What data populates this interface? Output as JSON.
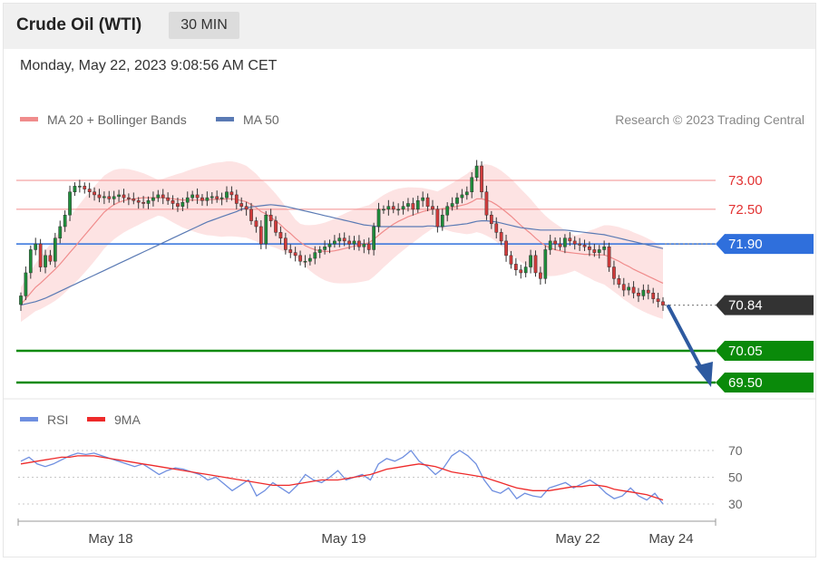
{
  "header": {
    "title": "Crude Oil (WTI)",
    "timeframe": "30 MIN"
  },
  "timestamp": "Monday, May 22, 2023 9:08:56 AM CET",
  "legend": {
    "ma20": "MA 20 + Bollinger Bands",
    "ma50": "MA 50",
    "credit": "Research © 2023 Trading Central"
  },
  "rsi_legend": {
    "rsi": "RSI",
    "ma9": "9MA"
  },
  "colors": {
    "up": "#1e8c3a",
    "down": "#d23b3b",
    "ma20": "#f08c8c",
    "bands": "#fde0e0",
    "ma50": "#5a7ab4",
    "pivot": "#2f6fdc",
    "support": "#0a8a0a",
    "current": "#333333",
    "rsi": "#6f8fe0",
    "rsi9": "#ee2a2a",
    "resistance": "#f28c8c",
    "arrow": "#2e5aa0"
  },
  "chart_data": [
    {
      "type": "candlestick",
      "title": "Crude Oil (WTI)",
      "timeframe": "30 MIN",
      "x_ticks": [
        "May 18",
        "May 19",
        "May 22",
        "May 24"
      ],
      "ylim": [
        69.3,
        73.6
      ],
      "levels": [
        {
          "value": 73.0,
          "label": "73.00",
          "kind": "resistance"
        },
        {
          "value": 72.5,
          "label": "72.50",
          "kind": "resistance"
        },
        {
          "value": 71.9,
          "label": "71.90",
          "kind": "pivot"
        },
        {
          "value": 70.84,
          "label": "70.84",
          "kind": "current"
        },
        {
          "value": 70.05,
          "label": "70.05",
          "kind": "support"
        },
        {
          "value": 69.5,
          "label": "69.50",
          "kind": "support"
        }
      ],
      "close": [
        71.0,
        71.4,
        71.8,
        71.9,
        71.5,
        71.7,
        71.6,
        72.0,
        72.2,
        72.4,
        72.8,
        72.9,
        72.9,
        72.85,
        72.8,
        72.75,
        72.7,
        72.72,
        72.68,
        72.72,
        72.75,
        72.7,
        72.68,
        72.65,
        72.62,
        72.6,
        72.65,
        72.7,
        72.75,
        72.7,
        72.65,
        72.6,
        72.55,
        72.62,
        72.7,
        72.75,
        72.7,
        72.65,
        72.7,
        72.72,
        72.68,
        72.7,
        72.8,
        72.75,
        72.6,
        72.55,
        72.5,
        72.3,
        72.2,
        71.9,
        72.4,
        72.3,
        72.1,
        72.0,
        71.8,
        71.75,
        71.7,
        71.6,
        71.6,
        71.65,
        71.75,
        71.8,
        71.85,
        71.9,
        71.95,
        72.0,
        71.95,
        71.9,
        71.95,
        71.85,
        71.9,
        71.8,
        72.2,
        72.5,
        72.5,
        72.55,
        72.5,
        72.5,
        72.55,
        72.6,
        72.5,
        72.65,
        72.7,
        72.55,
        72.5,
        72.2,
        72.4,
        72.55,
        72.6,
        72.7,
        72.75,
        72.8,
        73.05,
        73.25,
        72.8,
        72.4,
        72.25,
        72.1,
        71.95,
        71.7,
        71.55,
        71.45,
        71.4,
        71.5,
        71.7,
        71.4,
        71.3,
        71.8,
        71.95,
        71.9,
        71.85,
        72.0,
        71.95,
        71.9,
        71.88,
        71.85,
        71.8,
        71.75,
        71.8,
        71.85,
        71.5,
        71.3,
        71.2,
        71.1,
        71.15,
        71.05,
        71.0,
        71.1,
        71.05,
        70.95,
        70.9,
        70.84
      ],
      "ma20": [
        70.85,
        70.95,
        71.05,
        71.15,
        71.22,
        71.3,
        71.38,
        71.46,
        71.55,
        71.65,
        71.75,
        71.85,
        71.95,
        72.05,
        72.15,
        72.25,
        72.35,
        72.45,
        72.52,
        72.58,
        72.62,
        72.65,
        72.67,
        72.68,
        72.69,
        72.7,
        72.7,
        72.7,
        72.7,
        72.7,
        72.69,
        72.68,
        72.67,
        72.66,
        72.66,
        72.66,
        72.66,
        72.66,
        72.66,
        72.67,
        72.67,
        72.67,
        72.68,
        72.68,
        72.67,
        72.65,
        72.63,
        72.58,
        72.53,
        72.46,
        72.42,
        72.36,
        72.3,
        72.23,
        72.15,
        72.08,
        72.0,
        71.93,
        71.87,
        71.83,
        71.8,
        71.78,
        71.77,
        71.77,
        71.78,
        71.8,
        71.82,
        71.84,
        71.86,
        71.88,
        71.9,
        71.92,
        71.98,
        72.05,
        72.12,
        72.18,
        72.24,
        72.29,
        72.33,
        72.37,
        72.4,
        72.43,
        72.46,
        72.48,
        72.5,
        72.5,
        72.51,
        72.52,
        72.53,
        72.55,
        72.57,
        72.59,
        72.63,
        72.68,
        72.68,
        72.66,
        72.63,
        72.58,
        72.52,
        72.45,
        72.38,
        72.3,
        72.22,
        72.15,
        72.08,
        72.0,
        71.93,
        71.87,
        71.83,
        71.8,
        71.78,
        71.76,
        71.75,
        71.74,
        71.73,
        71.72,
        71.72,
        71.71,
        71.71,
        71.71,
        71.68,
        71.64,
        71.6,
        71.55,
        71.51,
        71.46,
        71.42,
        71.38,
        71.34,
        71.3,
        71.26,
        71.22
      ],
      "ma50": [
        70.84,
        70.86,
        70.88,
        70.9,
        70.93,
        70.96,
        71.0,
        71.04,
        71.08,
        71.12,
        71.16,
        71.2,
        71.24,
        71.28,
        71.32,
        71.36,
        71.4,
        71.44,
        71.48,
        71.52,
        71.56,
        71.6,
        71.64,
        71.68,
        71.72,
        71.76,
        71.8,
        71.84,
        71.88,
        71.92,
        71.96,
        72.0,
        72.04,
        72.08,
        72.12,
        72.16,
        72.2,
        72.24,
        72.28,
        72.31,
        72.34,
        72.37,
        72.4,
        72.43,
        72.46,
        72.5,
        72.52,
        72.54,
        72.55,
        72.56,
        72.57,
        72.58,
        72.57,
        72.56,
        72.55,
        72.53,
        72.51,
        72.49,
        72.47,
        72.45,
        72.43,
        72.41,
        72.39,
        72.37,
        72.35,
        72.33,
        72.31,
        72.29,
        72.27,
        72.25,
        72.23,
        72.22,
        72.21,
        72.2,
        72.2,
        72.2,
        72.2,
        72.2,
        72.2,
        72.2,
        72.2,
        72.2,
        72.2,
        72.21,
        72.21,
        72.2,
        72.2,
        72.21,
        72.22,
        72.23,
        72.24,
        72.25,
        72.27,
        72.29,
        72.3,
        72.3,
        72.29,
        72.28,
        72.26,
        72.24,
        72.22,
        72.2,
        72.18,
        72.17,
        72.16,
        72.15,
        72.14,
        72.14,
        72.14,
        72.14,
        72.14,
        72.14,
        72.13,
        72.12,
        72.11,
        72.1,
        72.09,
        72.08,
        72.07,
        72.06,
        72.04,
        72.02,
        72.0,
        71.98,
        71.96,
        71.94,
        71.92,
        71.9,
        71.88,
        71.86,
        71.84,
        71.82
      ]
    },
    {
      "type": "line",
      "ylim": [
        25,
        80
      ],
      "y_ticks": [
        70,
        50,
        30
      ],
      "series": [
        {
          "name": "RSI",
          "values": [
            62,
            65,
            60,
            58,
            60,
            63,
            66,
            68,
            67,
            68,
            66,
            64,
            62,
            60,
            58,
            60,
            56,
            52,
            55,
            57,
            56,
            54,
            52,
            48,
            50,
            45,
            40,
            44,
            48,
            36,
            40,
            46,
            42,
            38,
            44,
            52,
            48,
            46,
            50,
            55,
            48,
            50,
            52,
            48,
            60,
            64,
            62,
            65,
            70,
            62,
            58,
            52,
            57,
            66,
            70,
            66,
            60,
            48,
            40,
            38,
            42,
            34,
            38,
            36,
            35,
            42,
            44,
            46,
            42,
            45,
            48,
            44,
            38,
            34,
            36,
            42,
            36,
            33,
            38,
            30
          ]
        },
        {
          "name": "9MA",
          "values": [
            60,
            61,
            62,
            63,
            64,
            65,
            65,
            66,
            66,
            66,
            65,
            64,
            63,
            62,
            61,
            60,
            59,
            58,
            57,
            56,
            55,
            54,
            53,
            52,
            51,
            50,
            49,
            48,
            47,
            46,
            45,
            44,
            44,
            44,
            45,
            46,
            47,
            48,
            48,
            48,
            49,
            50,
            51,
            52,
            54,
            56,
            57,
            58,
            59,
            60,
            59,
            58,
            56,
            54,
            53,
            52,
            51,
            50,
            48,
            46,
            44,
            42,
            41,
            40,
            40,
            40,
            41,
            42,
            43,
            43,
            44,
            44,
            43,
            41,
            40,
            39,
            38,
            37,
            35,
            33
          ]
        }
      ]
    }
  ]
}
